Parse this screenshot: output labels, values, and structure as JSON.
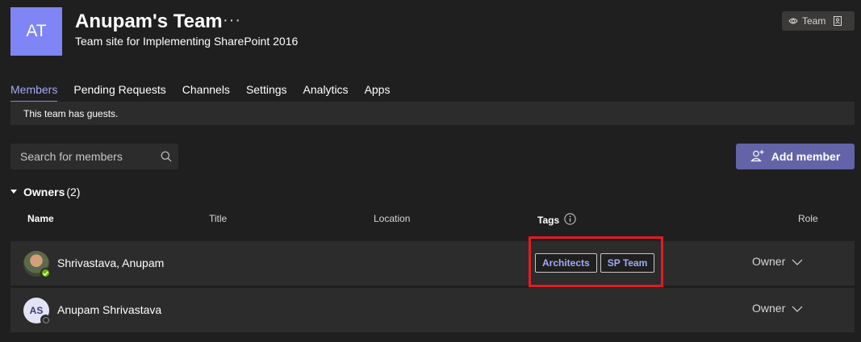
{
  "team": {
    "avatar_initials": "AT",
    "avatar_color": "#7f85f5",
    "name": "Anupam's Team",
    "more_icon": "ellipsis-icon",
    "description": "Team site for Implementing SharePoint 2016",
    "badge_label": "Team"
  },
  "tabs": [
    {
      "label": "Members",
      "active": true
    },
    {
      "label": "Pending Requests"
    },
    {
      "label": "Channels"
    },
    {
      "label": "Settings"
    },
    {
      "label": "Analytics"
    },
    {
      "label": "Apps"
    }
  ],
  "guest_banner": "This team has guests.",
  "search": {
    "placeholder": "Search for members"
  },
  "add_member_label": "Add member",
  "group": {
    "title": "Owners",
    "count": "(2)"
  },
  "columns": {
    "name": "Name",
    "title": "Title",
    "location": "Location",
    "tags": "Tags",
    "role": "Role"
  },
  "members": [
    {
      "name": "Shrivastava, Anupam",
      "avatar": "photo",
      "presence": "available",
      "tags": [
        "Architects",
        "SP Team"
      ],
      "role": "Owner"
    },
    {
      "name": "Anupam Shrivastava",
      "avatar_initials": "AS",
      "presence": "offline",
      "tags": [],
      "role": "Owner"
    }
  ],
  "colors": {
    "accent": "#6264a7",
    "tag_text": "#a4a9f7",
    "highlight": "#e41b23",
    "presence_available": "#6bb700"
  }
}
